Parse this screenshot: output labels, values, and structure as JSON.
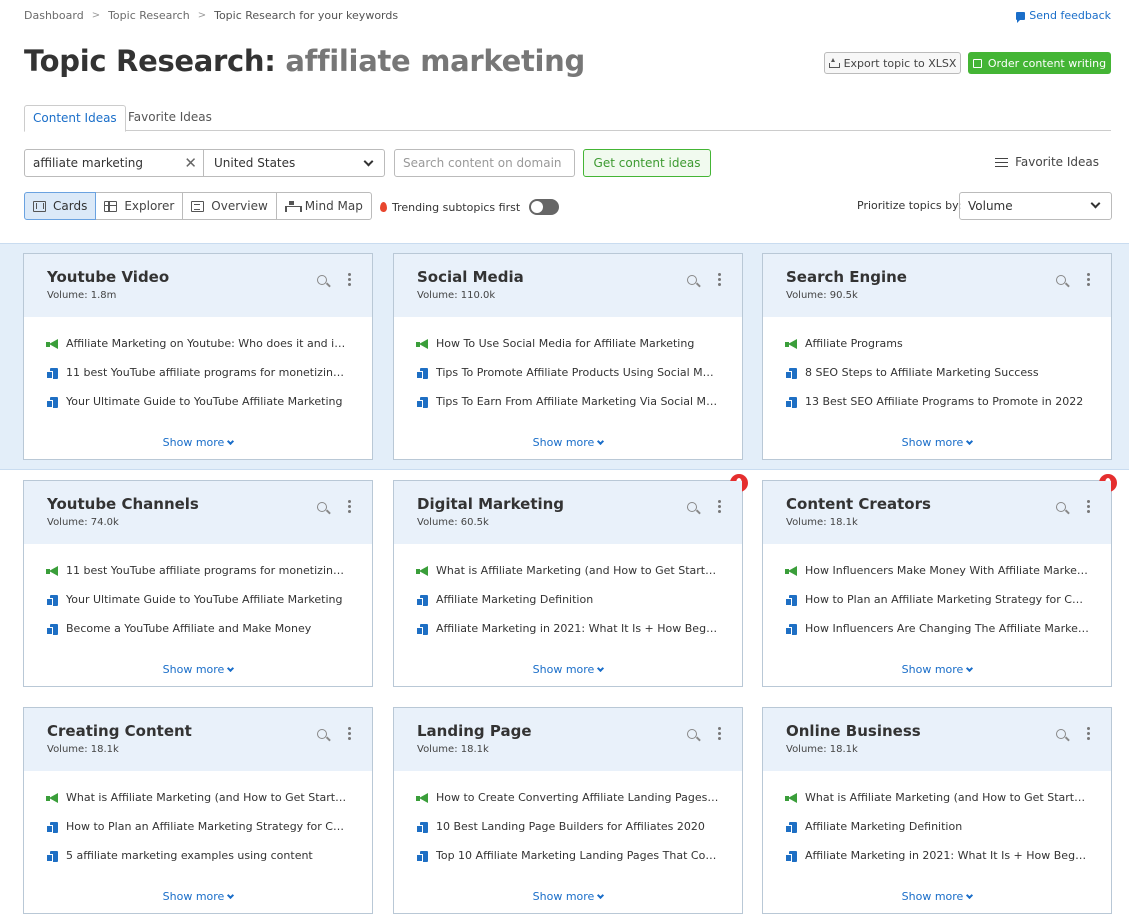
{
  "breadcrumb": [
    "Dashboard",
    "Topic Research",
    "Topic Research for your keywords"
  ],
  "feedback_label": "Send feedback",
  "title": {
    "prefix": "Topic Research:",
    "keyword": "affiliate marketing"
  },
  "header_buttons": {
    "export": "Export topic to XLSX",
    "order": "Order content writing"
  },
  "tabs": [
    "Content Ideas",
    "Favorite Ideas"
  ],
  "search": {
    "keyword_value": "affiliate marketing",
    "country": "United States",
    "domain_placeholder": "Search content on domain",
    "get_button": "Get content ideas",
    "favorite_ideas": "Favorite Ideas"
  },
  "views": [
    "Cards",
    "Explorer",
    "Overview",
    "Mind Map"
  ],
  "active_view": "Cards",
  "trending_label": "Trending subtopics first",
  "trending_on": false,
  "prioritize": {
    "label": "Prioritize topics by:",
    "value": "Volume"
  },
  "show_more": "Show more",
  "cards": [
    {
      "title": "Youtube Video",
      "volume": "Volume: 1.8m",
      "hot": false,
      "items": [
        {
          "type": "megaphone-icon",
          "text": "Affiliate Marketing on Youtube: Who does it and is i..."
        },
        {
          "type": "article-icon",
          "text": "11 best YouTube affiliate programs for monetizing ..."
        },
        {
          "type": "article-icon",
          "text": "Your Ultimate Guide to YouTube Affiliate Marketing"
        }
      ]
    },
    {
      "title": "Social Media",
      "volume": "Volume: 110.0k",
      "hot": false,
      "items": [
        {
          "type": "megaphone-icon",
          "text": "How To Use Social Media for Affiliate Marketing"
        },
        {
          "type": "article-icon",
          "text": "Tips To Promote Affiliate Products Using Social Media"
        },
        {
          "type": "article-icon",
          "text": "Tips To Earn From Affiliate Marketing Via Social Media"
        }
      ]
    },
    {
      "title": "Search Engine",
      "volume": "Volume: 90.5k",
      "hot": false,
      "items": [
        {
          "type": "megaphone-icon",
          "text": "Affiliate Programs"
        },
        {
          "type": "article-icon",
          "text": "8 SEO Steps to Affiliate Marketing Success"
        },
        {
          "type": "article-icon",
          "text": "13 Best SEO Affiliate Programs to Promote in 2022"
        }
      ]
    },
    {
      "title": "Youtube Channels",
      "volume": "Volume: 74.0k",
      "hot": false,
      "items": [
        {
          "type": "megaphone-icon",
          "text": "11 best YouTube affiliate programs for monetizing ..."
        },
        {
          "type": "article-icon",
          "text": "Your Ultimate Guide to YouTube Affiliate Marketing"
        },
        {
          "type": "article-icon",
          "text": "Become a YouTube Affiliate and Make Money"
        }
      ]
    },
    {
      "title": "Digital Marketing",
      "volume": "Volume: 60.5k",
      "hot": true,
      "items": [
        {
          "type": "megaphone-icon",
          "text": "What is Affiliate Marketing (and How to Get Started)"
        },
        {
          "type": "article-icon",
          "text": "Affiliate Marketing Definition"
        },
        {
          "type": "article-icon",
          "text": "Affiliate Marketing in 2021: What It Is + How Beginn..."
        }
      ]
    },
    {
      "title": "Content Creators",
      "volume": "Volume: 18.1k",
      "hot": true,
      "items": [
        {
          "type": "megaphone-icon",
          "text": "How Influencers Make Money With Affiliate Marketi..."
        },
        {
          "type": "article-icon",
          "text": "How to Plan an Affiliate Marketing Strategy for Con..."
        },
        {
          "type": "article-icon",
          "text": "How Influencers Are Changing The Affiliate Marketi..."
        }
      ]
    },
    {
      "title": "Creating Content",
      "volume": "Volume: 18.1k",
      "hot": false,
      "items": [
        {
          "type": "megaphone-icon",
          "text": "What is Affiliate Marketing (and How to Get Started)"
        },
        {
          "type": "article-icon",
          "text": "How to Plan an Affiliate Marketing Strategy for Con..."
        },
        {
          "type": "article-icon",
          "text": "5 affiliate marketing examples using content"
        }
      ]
    },
    {
      "title": "Landing Page",
      "volume": "Volume: 18.1k",
      "hot": false,
      "items": [
        {
          "type": "megaphone-icon",
          "text": "How to Create Converting Affiliate Landing Pages i..."
        },
        {
          "type": "article-icon",
          "text": "10 Best Landing Page Builders for Affiliates 2020"
        },
        {
          "type": "article-icon",
          "text": "Top 10 Affiliate Marketing Landing Pages That Conv..."
        }
      ]
    },
    {
      "title": "Online Business",
      "volume": "Volume: 18.1k",
      "hot": false,
      "items": [
        {
          "type": "megaphone-icon",
          "text": "What is Affiliate Marketing (and How to Get Started)"
        },
        {
          "type": "article-icon",
          "text": "Affiliate Marketing Definition"
        },
        {
          "type": "article-icon",
          "text": "Affiliate Marketing in 2021: What It Is + How Beginn..."
        }
      ]
    }
  ]
}
